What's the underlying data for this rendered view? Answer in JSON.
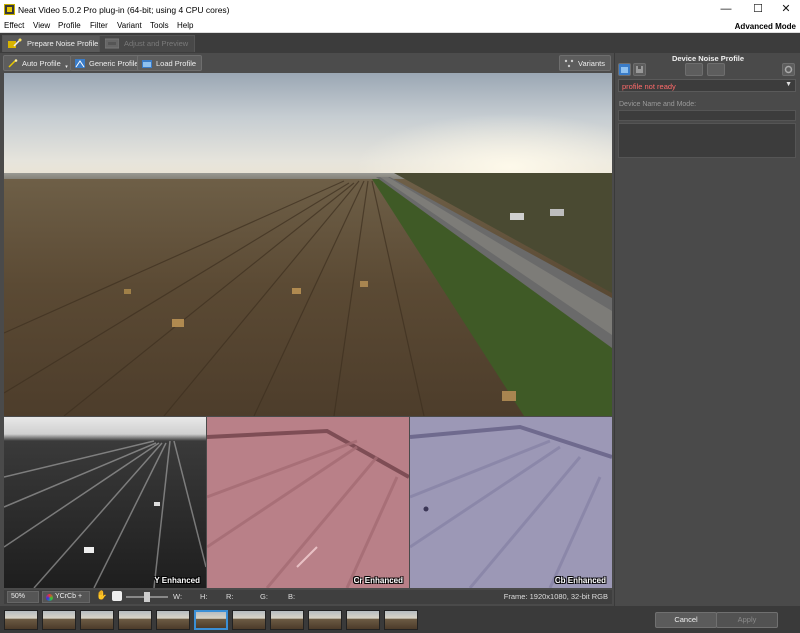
{
  "window": {
    "title": "Neat Video 5.0.2 Pro plug-in (64-bit; using 4 CPU cores)",
    "minimize_glyph": "—",
    "maximize_glyph": "☐",
    "close_glyph": "✕"
  },
  "menubar": {
    "items": [
      "Effect",
      "View",
      "Profile",
      "Filter",
      "Variant",
      "Tools",
      "Help"
    ],
    "mode_label": "Advanced Mode"
  },
  "tabs": {
    "prepare": "Prepare Noise Profile",
    "adjust": "Adjust and Preview"
  },
  "toolbar": {
    "auto_profile": "Auto Profile",
    "generic_profile": "Generic Profile",
    "load_profile": "Load Profile",
    "variants": "Variants"
  },
  "channels": {
    "y": "Y Enhanced",
    "cr": "Cr Enhanced",
    "cb": "Cb Enhanced"
  },
  "statusbar": {
    "zoom": "50%",
    "color_mode": "YCrCb +",
    "w_label": "W:",
    "h_label": "H:",
    "r_label": "R:",
    "g_label": "G:",
    "b_label": "B:",
    "frame_info": "Frame: 1920x1080, 32-bit RGB"
  },
  "right_panel": {
    "title": "Device Noise Profile",
    "profile_status": "profile not ready",
    "device_label": "Device Name and Mode:"
  },
  "buttons": {
    "cancel": "Cancel",
    "apply": "Apply"
  },
  "colors": {
    "accent_selected_frame": "#3a8fd6",
    "profile_warning": "#ff6a6a",
    "cr_tint": "#b98088",
    "cb_tint": "#9c98b6"
  },
  "icons": {
    "tab_prepare": "noise-profile-wand-icon",
    "tab_adjust": "adjust-preview-icon",
    "auto_profile": "magic-wand-icon",
    "generic_profile": "generic-profile-icon",
    "load_profile": "folder-icon",
    "variants": "variants-icon"
  }
}
